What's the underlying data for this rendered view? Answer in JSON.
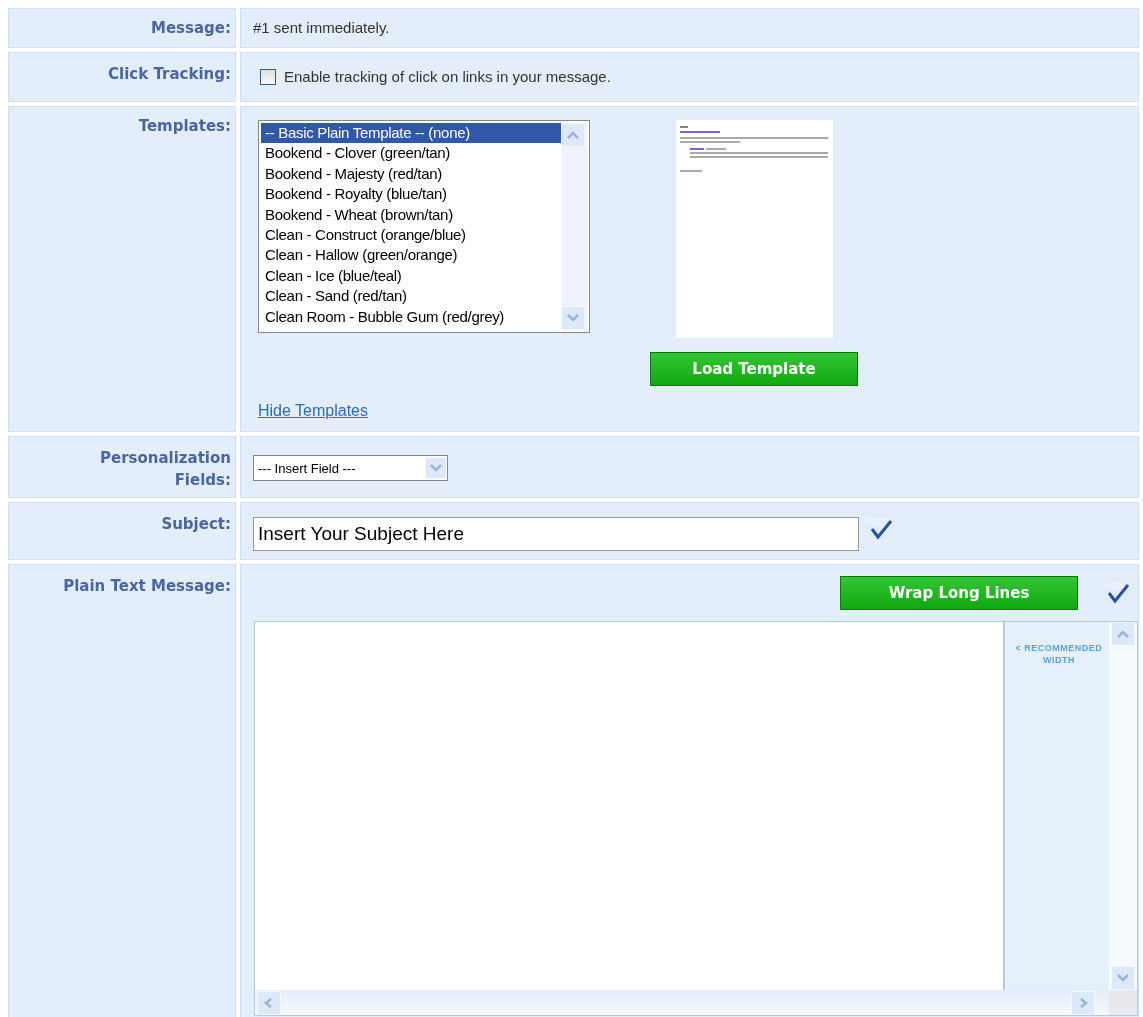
{
  "message": {
    "label": "Message:",
    "value": "#1 sent immediately."
  },
  "click_tracking": {
    "label": "Click Tracking:",
    "checkbox": {
      "label": "Enable tracking of click on links in your message.",
      "checked": false
    }
  },
  "templates": {
    "label": "Templates:",
    "options": [
      {
        "label": "-- Basic Plain Template -- (none)",
        "selected": true
      },
      {
        "label": "Bookend - Clover (green/tan)",
        "selected": false
      },
      {
        "label": "Bookend - Majesty (red/tan)",
        "selected": false
      },
      {
        "label": "Bookend - Royalty (blue/tan)",
        "selected": false
      },
      {
        "label": "Bookend - Wheat (brown/tan)",
        "selected": false
      },
      {
        "label": "Clean - Construct (orange/blue)",
        "selected": false
      },
      {
        "label": "Clean - Hallow (green/orange)",
        "selected": false
      },
      {
        "label": "Clean - Ice (blue/teal)",
        "selected": false
      },
      {
        "label": "Clean - Sand (red/tan)",
        "selected": false
      },
      {
        "label": "Clean Room - Bubble Gum (red/grey)",
        "selected": false
      }
    ],
    "button": "Load Template",
    "link": "Hide Templates"
  },
  "personalization": {
    "label": "Personalization Fields:",
    "select": "--- Insert Field ---"
  },
  "subject": {
    "label": "Subject:",
    "value": "Insert Your Subject Here"
  },
  "plain_text": {
    "label": "Plain Text Message:",
    "button": "Wrap Long Lines",
    "hint": "< RECOMMENDED WIDTH"
  }
}
